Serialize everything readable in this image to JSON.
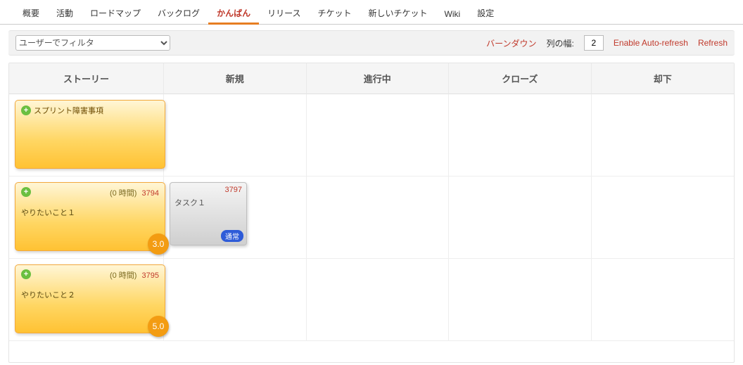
{
  "nav": {
    "tabs": [
      "概要",
      "活動",
      "ロードマップ",
      "バックログ",
      "かんばん",
      "リリース",
      "チケット",
      "新しいチケット",
      "Wiki",
      "設定"
    ],
    "active_index": 4
  },
  "toolbar": {
    "filter_placeholder": "ユーザーでフィルタ",
    "burndown": "バーンダウン",
    "col_width_label": "列の幅:",
    "col_width_value": "2",
    "auto_refresh": "Enable Auto-refresh",
    "refresh": "Refresh"
  },
  "columns": [
    "ストーリー",
    "新規",
    "進行中",
    "クローズ",
    "却下"
  ],
  "lanes": [
    {
      "story": {
        "title": "スプリント障害事項"
      },
      "tasks": []
    },
    {
      "story": {
        "hours": "(0 時間)",
        "ticket": "3794",
        "desc": "やりたいこと１",
        "points": "3.0"
      },
      "tasks": [
        {
          "col": 1,
          "ticket": "3797",
          "title": "タスク１",
          "badge": "通常"
        }
      ]
    },
    {
      "story": {
        "hours": "(0 時間)",
        "ticket": "3795",
        "desc": "やりたいこと２",
        "points": "5.0"
      },
      "tasks": []
    }
  ]
}
